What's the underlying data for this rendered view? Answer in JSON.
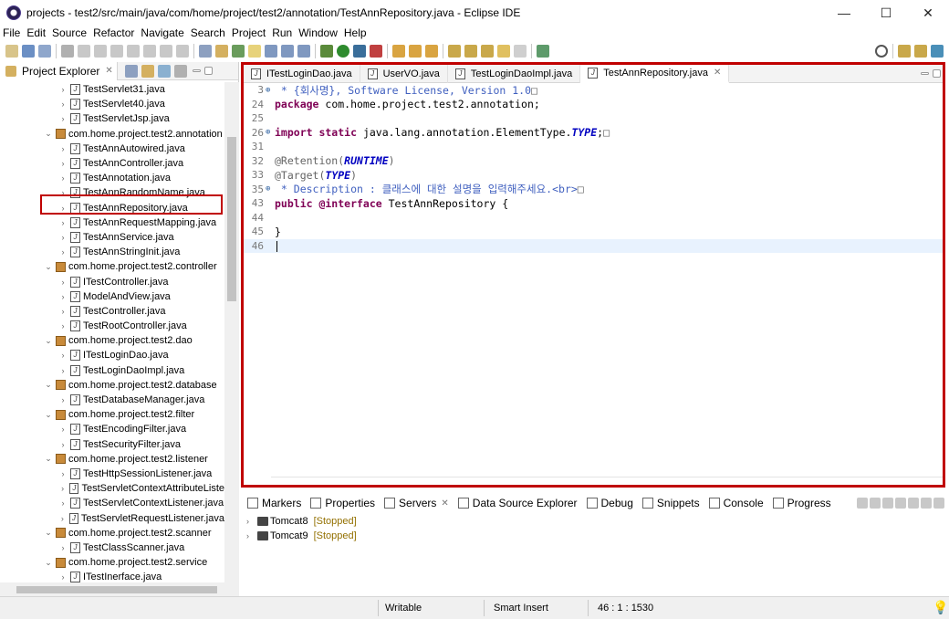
{
  "window": {
    "title": "projects - test2/src/main/java/com/home/project/test2/annotation/TestAnnRepository.java - Eclipse IDE",
    "min": "—",
    "max": "☐",
    "close": "✕"
  },
  "menu": [
    "File",
    "Edit",
    "Source",
    "Refactor",
    "Navigate",
    "Search",
    "Project",
    "Run",
    "Window",
    "Help"
  ],
  "explorer": {
    "tab_label": "Project Explorer",
    "rows": [
      {
        "label": "TestServlet31.java",
        "kind": "file",
        "indent": 1
      },
      {
        "label": "TestServlet40.java",
        "kind": "file",
        "indent": 1
      },
      {
        "label": "TestServletJsp.java",
        "kind": "file",
        "indent": 1
      },
      {
        "label": "com.home.project.test2.annotation",
        "kind": "pkg",
        "indent": 0
      },
      {
        "label": "TestAnnAutowired.java",
        "kind": "file",
        "indent": 1
      },
      {
        "label": "TestAnnController.java",
        "kind": "file",
        "indent": 1
      },
      {
        "label": "TestAnnotation.java",
        "kind": "file",
        "indent": 1
      },
      {
        "label": "TestAnnRandomName.java",
        "kind": "file",
        "indent": 1
      },
      {
        "label": "TestAnnRepository.java",
        "kind": "file",
        "indent": 1
      },
      {
        "label": "TestAnnRequestMapping.java",
        "kind": "file",
        "indent": 1
      },
      {
        "label": "TestAnnService.java",
        "kind": "file",
        "indent": 1
      },
      {
        "label": "TestAnnStringInit.java",
        "kind": "file",
        "indent": 1
      },
      {
        "label": "com.home.project.test2.controller",
        "kind": "pkg",
        "indent": 0
      },
      {
        "label": "ITestController.java",
        "kind": "file",
        "indent": 1
      },
      {
        "label": "ModelAndView.java",
        "kind": "file",
        "indent": 1
      },
      {
        "label": "TestController.java",
        "kind": "file",
        "indent": 1
      },
      {
        "label": "TestRootController.java",
        "kind": "file",
        "indent": 1
      },
      {
        "label": "com.home.project.test2.dao",
        "kind": "pkg",
        "indent": 0
      },
      {
        "label": "ITestLoginDao.java",
        "kind": "file",
        "indent": 1
      },
      {
        "label": "TestLoginDaoImpl.java",
        "kind": "file",
        "indent": 1
      },
      {
        "label": "com.home.project.test2.database",
        "kind": "pkg",
        "indent": 0
      },
      {
        "label": "TestDatabaseManager.java",
        "kind": "file",
        "indent": 1
      },
      {
        "label": "com.home.project.test2.filter",
        "kind": "pkg",
        "indent": 0
      },
      {
        "label": "TestEncodingFilter.java",
        "kind": "file",
        "indent": 1
      },
      {
        "label": "TestSecurityFilter.java",
        "kind": "file",
        "indent": 1
      },
      {
        "label": "com.home.project.test2.listener",
        "kind": "pkg",
        "indent": 0
      },
      {
        "label": "TestHttpSessionListener.java",
        "kind": "file",
        "indent": 1
      },
      {
        "label": "TestServletContextAttributeListe",
        "kind": "file",
        "indent": 1
      },
      {
        "label": "TestServletContextListener.java",
        "kind": "file",
        "indent": 1
      },
      {
        "label": "TestServletRequestListener.java",
        "kind": "file",
        "indent": 1
      },
      {
        "label": "com.home.project.test2.scanner",
        "kind": "pkg",
        "indent": 0
      },
      {
        "label": "TestClassScanner.java",
        "kind": "file",
        "indent": 1
      },
      {
        "label": "com.home.project.test2.service",
        "kind": "pkg",
        "indent": 0
      },
      {
        "label": "ITestInerface.java",
        "kind": "file",
        "indent": 1
      }
    ]
  },
  "editor": {
    "tabs": [
      "ITestLoginDao.java",
      "UserVO.java",
      "TestLoginDaoImpl.java",
      "TestAnnRepository.java"
    ],
    "active_tab": 3,
    "lines": [
      {
        "n": "3",
        "fold": true,
        "html": "<span class='cm'> * {회사명}, Software License, Version 1.0</span><span class='an'>□</span>"
      },
      {
        "n": "24",
        "html": "<span class='kw'>package</span> com.home.project.test2.annotation;"
      },
      {
        "n": "25",
        "html": ""
      },
      {
        "n": "26",
        "fold": true,
        "html": "<span class='kw'>import static</span> java.lang.annotation.ElementType.<span class='en'>TYPE</span>;<span class='an'>□</span>"
      },
      {
        "n": "31",
        "html": ""
      },
      {
        "n": "32",
        "html": "<span class='an'>@Retention(</span><span class='en'>RUNTIME</span><span class='an'>)</span>"
      },
      {
        "n": "33",
        "html": "<span class='an'>@Target(</span><span class='en'>TYPE</span><span class='an'>)</span>"
      },
      {
        "n": "35",
        "fold": true,
        "html": "<span class='cm'> * Description : 클래스에 대한 설명을 입력해주세요.&lt;br&gt;</span><span class='an'>□</span>"
      },
      {
        "n": "43",
        "html": "<span class='kw'>public @interface</span> TestAnnRepository {"
      },
      {
        "n": "44",
        "html": ""
      },
      {
        "n": "45",
        "html": "}"
      },
      {
        "n": "46",
        "html": "",
        "current": true
      }
    ]
  },
  "bottom": {
    "tabs": [
      "Markers",
      "Properties",
      "Servers",
      "Data Source Explorer",
      "Debug",
      "Snippets",
      "Console",
      "Progress"
    ],
    "active_tab": 2,
    "servers": [
      {
        "name": "Tomcat8",
        "state": "[Stopped]"
      },
      {
        "name": "Tomcat9",
        "state": "[Stopped]"
      }
    ]
  },
  "status": {
    "writable": "Writable",
    "insert": "Smart Insert",
    "position": "46 : 1 : 1530"
  }
}
